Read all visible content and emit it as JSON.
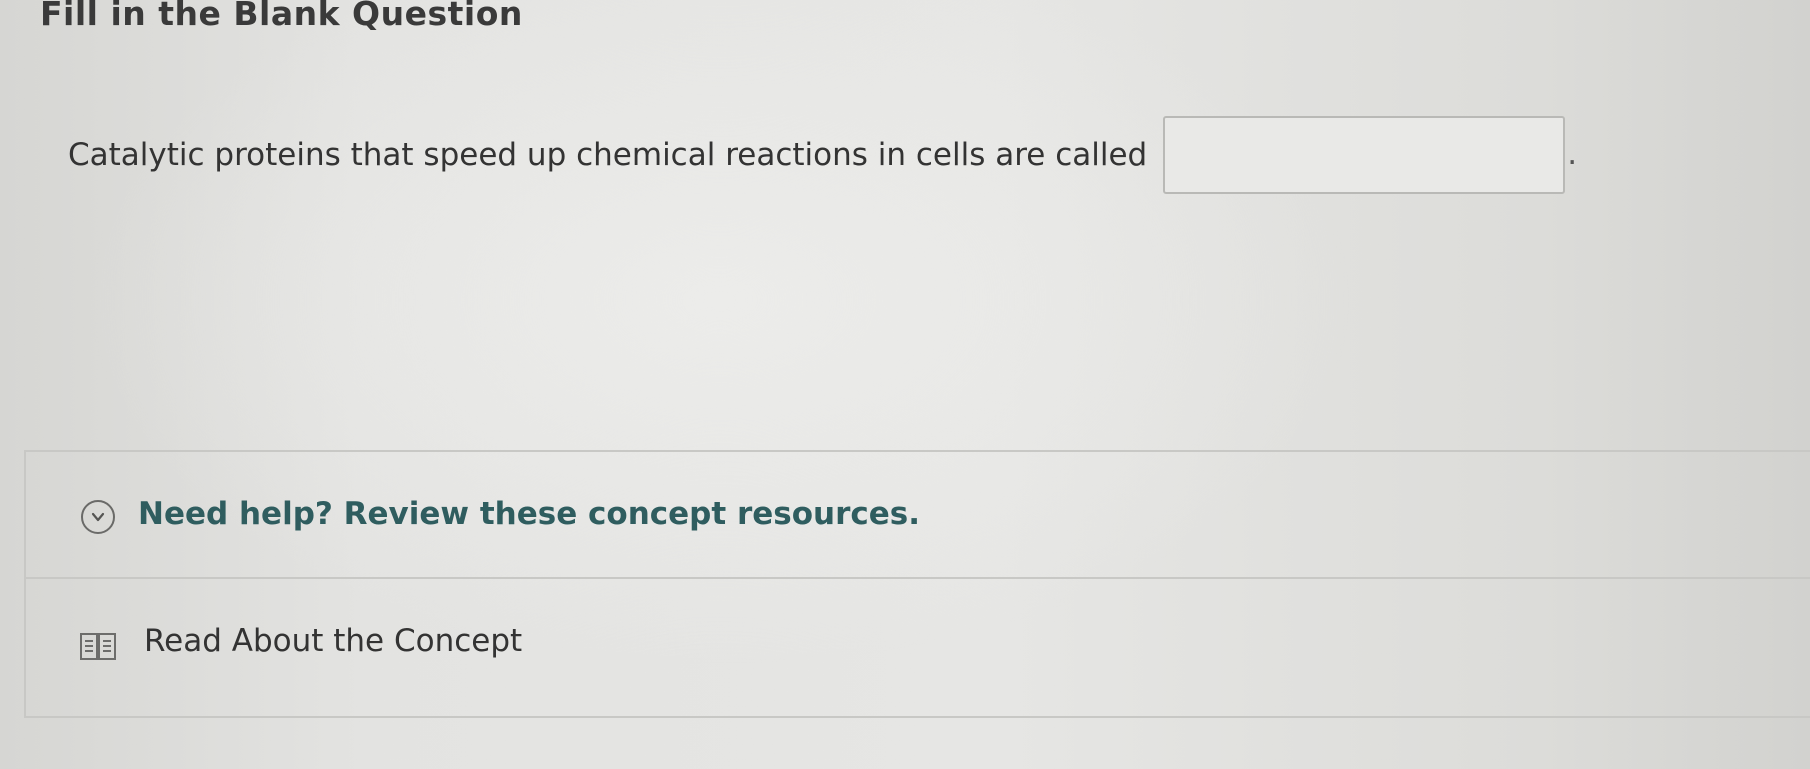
{
  "header": {
    "title": "Fill in the Blank Question"
  },
  "question": {
    "text": "Catalytic proteins that speed up chemical reactions in cells are called",
    "blank_value": "",
    "end_punctuation": "."
  },
  "help": {
    "toggle_label": "Need help? Review these concept resources.",
    "toggle_icon": "chevron-down-icon",
    "resources": [
      {
        "label": "Read About the Concept",
        "icon": "book-icon"
      }
    ]
  },
  "colors": {
    "help_title": "#2f5d5f",
    "border": "#c8c8c5"
  }
}
